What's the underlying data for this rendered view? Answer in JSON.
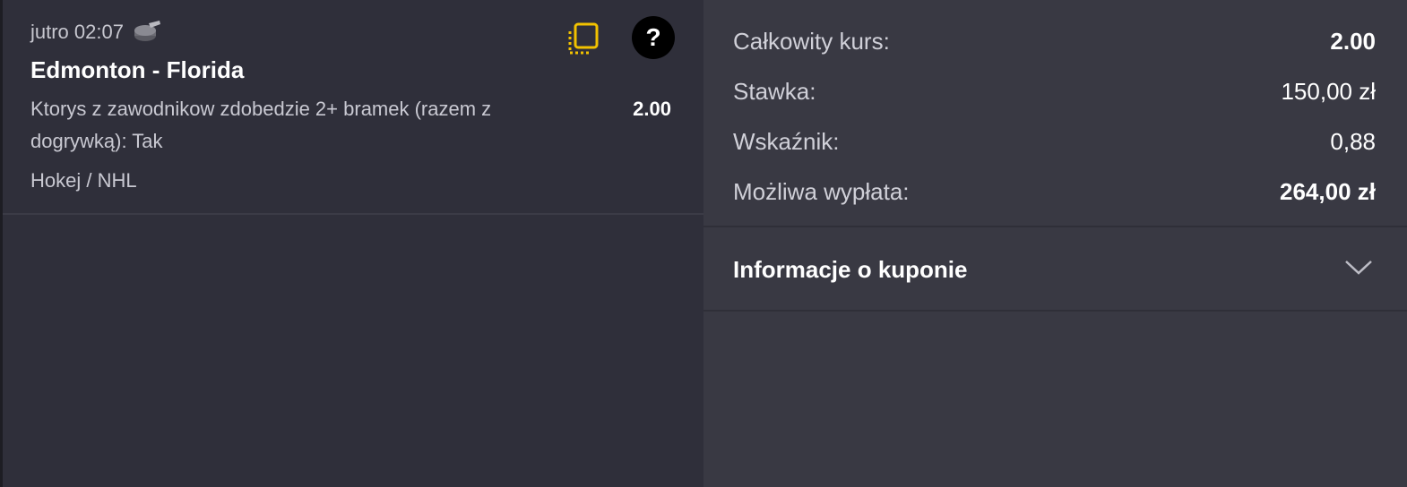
{
  "bet": {
    "time": "jutro 02:07",
    "sport_icon": "hockey-puck-icon",
    "event": "Edmonton - Florida",
    "selection": "Ktorys z zawodnikow zdobedzie 2+ bramek (razem z dogrywką): Tak",
    "odds": "2.00",
    "category": "Hokej / NHL",
    "copy_icon": "copy-icon",
    "help_icon": "help-icon",
    "help_symbol": "?"
  },
  "summary": {
    "total_odds_label": "Całkowity kurs:",
    "total_odds_value": "2.00",
    "stake_label": "Stawka:",
    "stake_value": "150,00 zł",
    "indicator_label": "Wskaźnik:",
    "indicator_value": "0,88",
    "payout_label": "Możliwa wypłata:",
    "payout_value": "264,00 zł"
  },
  "info": {
    "title": "Informacje o kuponie",
    "chevron_icon": "chevron-down-icon"
  },
  "colors": {
    "left_bg": "#2f2f3a",
    "right_bg": "#393943",
    "accent_yellow": "#f2c200",
    "text_primary": "#ffffff",
    "text_secondary": "#c9c9d2"
  }
}
